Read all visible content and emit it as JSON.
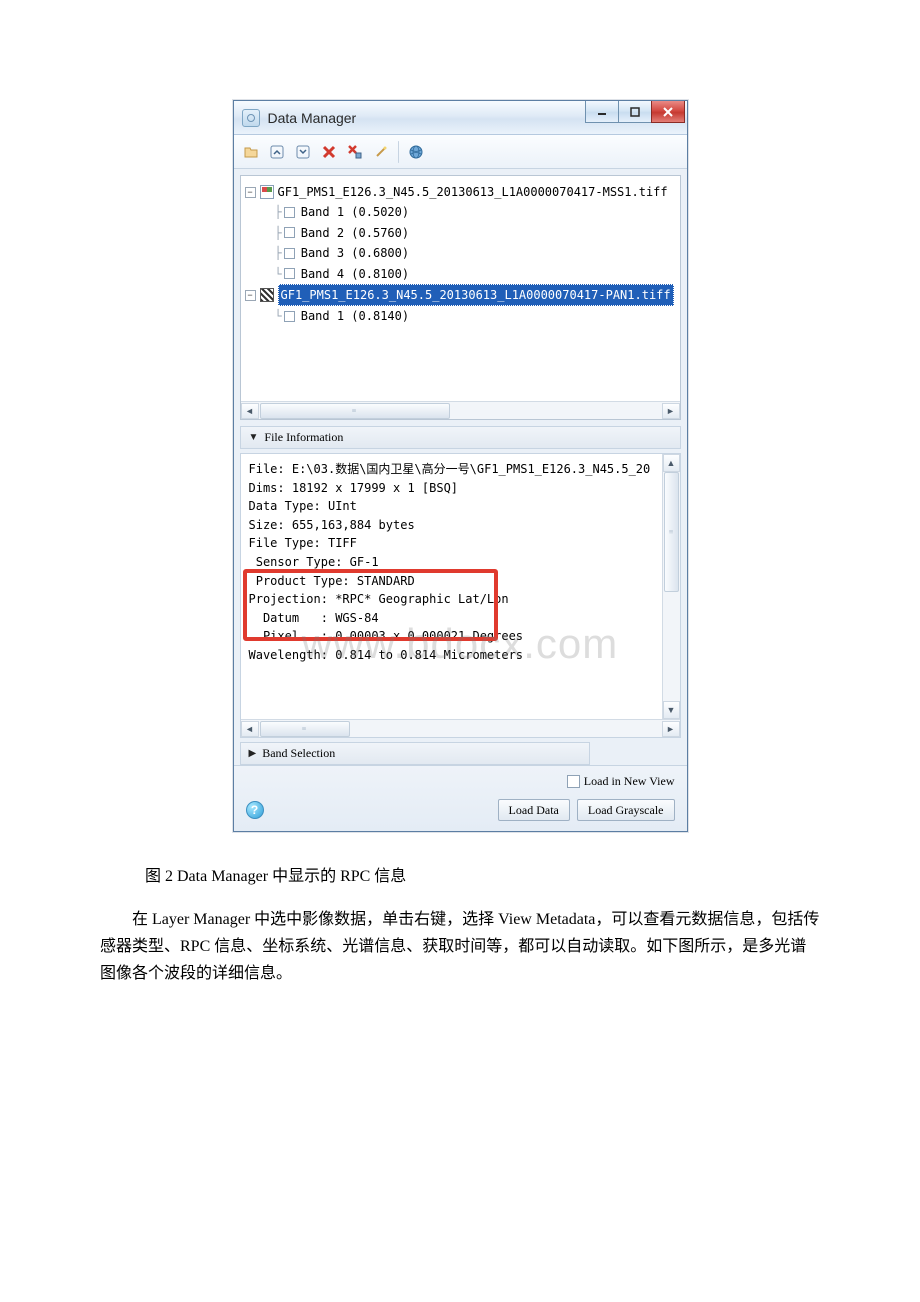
{
  "window": {
    "title": "Data Manager",
    "controls": {
      "min": "minimize-icon",
      "max": "maximize-icon",
      "close": "close-icon"
    }
  },
  "toolbar": {
    "icons": [
      "open-file-icon",
      "collapse-up-icon",
      "expand-down-icon",
      "remove-x-icon",
      "remove-all-icon",
      "settings-wand-icon",
      "globe-icon"
    ]
  },
  "tree": {
    "file1": {
      "name": "GF1_PMS1_E126.3_N45.5_20130613_L1A0000070417-MSS1.tiff",
      "bands": [
        {
          "label": "Band 1  (0.5020)"
        },
        {
          "label": "Band 2  (0.5760)"
        },
        {
          "label": "Band 3  (0.6800)"
        },
        {
          "label": "Band 4  (0.8100)"
        }
      ]
    },
    "file2": {
      "name": "GF1_PMS1_E126.3_N45.5_20130613_L1A0000070417-PAN1.tiff",
      "bands": [
        {
          "label": "Band 1  (0.8140)"
        }
      ]
    }
  },
  "sections": {
    "file_info": "File Information",
    "band_sel": "Band Selection"
  },
  "file_info": {
    "line_file": "File: E:\\03.数据\\国内卫星\\高分一号\\GF1_PMS1_E126.3_N45.5_20",
    "line_dims": "Dims: 18192 x 17999 x 1 [BSQ]",
    "line_dtype": "Data Type: UInt",
    "line_size": "Size: 655,163,884 bytes",
    "line_ftype": "File Type: TIFF",
    "line_sensor": " Sensor Type: GF-1",
    "line_product": " Product Type: STANDARD",
    "line_proj": "Projection: *RPC* Geographic Lat/Lon",
    "line_datum": "  Datum   : WGS-84",
    "line_pixel": "  Pixel   : 0.00003 x 0.000021 Degrees",
    "line_wave": "Wavelength: 0.814 to 0.814 Micrometers"
  },
  "bottom": {
    "load_new_view": "Load in New View",
    "load_data": "Load Data",
    "load_gray": "Load Grayscale"
  },
  "doc": {
    "caption": "图 2 Data Manager 中显示的 RPC 信息",
    "paragraph": "在 Layer Manager 中选中影像数据，单击右键，选择 View Metadata，可以查看元数据信息，包括传感器类型、RPC 信息、坐标系统、光谱信息、获取时间等，都可以自动读取。如下图所示，是多光谱图像各个波段的详细信息。"
  },
  "watermark": "www.bdocx.com"
}
